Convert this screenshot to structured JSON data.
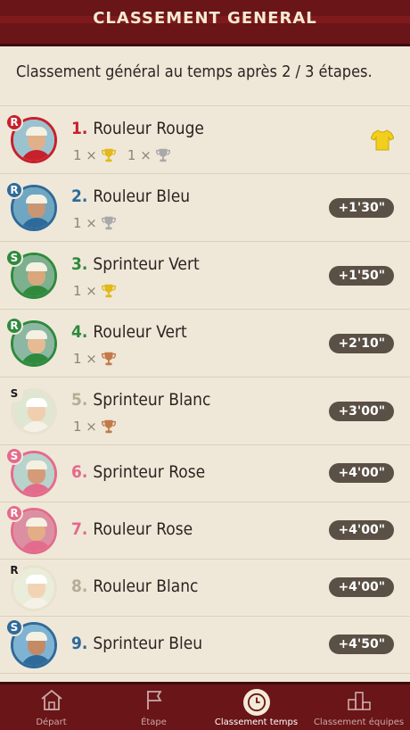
{
  "header": {
    "title": "CLASSEMENT GENERAL"
  },
  "subtitle": "Classement général au temps après 2 / 3 étapes.",
  "colors": {
    "red": "#c8202c",
    "blue": "#2e6a9a",
    "green": "#2f8a3e",
    "white_badge": "#1a1a1a",
    "pink": "#e36b8b",
    "gold": "#e2b81a",
    "silver": "#a9a9a9",
    "bronze": "#c27a4a"
  },
  "riders": [
    {
      "num": "1.",
      "name": "Rouleur Rouge",
      "badge": "R",
      "color": "#c8202c",
      "time": "",
      "leader": true,
      "trophies": [
        {
          "count": "1 ×",
          "kind": "gold"
        },
        {
          "count": "1 ×",
          "kind": "silver"
        }
      ]
    },
    {
      "num": "2.",
      "name": "Rouleur Bleu",
      "badge": "R",
      "color": "#2e6a9a",
      "time": "+1'30\"",
      "leader": false,
      "trophies": [
        {
          "count": "1 ×",
          "kind": "silver"
        }
      ]
    },
    {
      "num": "3.",
      "name": "Sprinteur Vert",
      "badge": "S",
      "color": "#2f8a3e",
      "time": "+1'50\"",
      "leader": false,
      "trophies": [
        {
          "count": "1 ×",
          "kind": "gold"
        }
      ]
    },
    {
      "num": "4.",
      "name": "Rouleur Vert",
      "badge": "R",
      "color": "#2f8a3e",
      "time": "+2'10\"",
      "leader": false,
      "trophies": [
        {
          "count": "1 ×",
          "kind": "bronze"
        }
      ]
    },
    {
      "num": "5.",
      "name": "Sprinteur Blanc",
      "badge": "S",
      "color": "#efe8d9",
      "time": "+3'00\"",
      "leader": false,
      "trophies": [
        {
          "count": "1 ×",
          "kind": "bronze"
        }
      ]
    },
    {
      "num": "6.",
      "name": "Sprinteur Rose",
      "badge": "S",
      "color": "#e36b8b",
      "time": "+4'00\"",
      "leader": false,
      "trophies": []
    },
    {
      "num": "7.",
      "name": "Rouleur Rose",
      "badge": "R",
      "color": "#e36b8b",
      "time": "+4'00\"",
      "leader": false,
      "trophies": []
    },
    {
      "num": "8.",
      "name": "Rouleur Blanc",
      "badge": "R",
      "color": "#efe8d9",
      "time": "+4'00\"",
      "leader": false,
      "trophies": []
    },
    {
      "num": "9.",
      "name": "Sprinteur Bleu",
      "badge": "S",
      "color": "#2e6a9a",
      "time": "+4'50\"",
      "leader": false,
      "trophies": []
    }
  ],
  "tabs": [
    {
      "label": "Départ",
      "icon": "home-icon",
      "active": false
    },
    {
      "label": "Étape",
      "icon": "flag-icon",
      "active": false
    },
    {
      "label": "Classement temps",
      "icon": "clock-icon",
      "active": true
    },
    {
      "label": "Classement équipes",
      "icon": "podium-icon",
      "active": false
    }
  ]
}
